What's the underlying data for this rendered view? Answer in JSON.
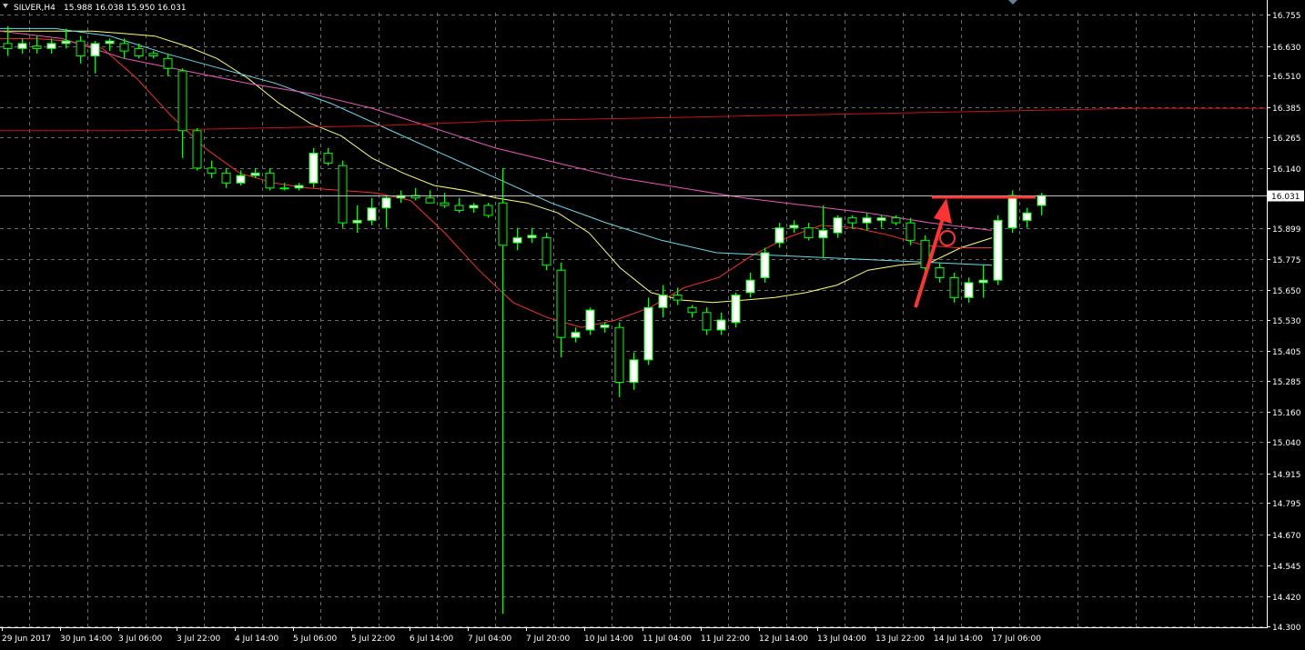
{
  "header": {
    "symbol_label": "SILVER,H4",
    "ohlc": "15.988 16.038 15.950 16.031"
  },
  "colors": {
    "background": "#000000",
    "grid": "#6b6b6b",
    "bull_candle": "#ffffff",
    "bear_candle": "#000000",
    "wick": "#00ff00",
    "ma_yellow": "#ffff66",
    "ma_red": "#ff2a2a",
    "ma_cyan": "#66ddee",
    "ma_magenta": "#ee55bb",
    "ma_darkred": "#cc1111",
    "annotation": "#ff3333",
    "current_price_line": "#bfbfbf"
  },
  "chart_data": {
    "type": "candlestick",
    "timeframe": "H4",
    "y_ticks": [
      16.755,
      16.63,
      16.51,
      16.385,
      16.265,
      16.14,
      15.899,
      15.775,
      15.65,
      15.53,
      15.405,
      15.285,
      15.16,
      15.04,
      14.915,
      14.795,
      14.67,
      14.545,
      14.42,
      14.3
    ],
    "y_tick_labels": [
      "16.755",
      "16.630",
      "16.510",
      "16.385",
      "16.265",
      "16.140",
      "15.899",
      "15.775",
      "15.650",
      "15.530",
      "15.405",
      "15.285",
      "15.160",
      "15.040",
      "14.915",
      "14.795",
      "14.670",
      "14.545",
      "14.420",
      "14.300"
    ],
    "ylim": [
      14.3,
      16.76
    ],
    "current_price": 16.031,
    "current_price_label": "16.031",
    "x_labels": [
      "29 Jun 2017",
      "30 Jun 14:00",
      "3 Jul 06:00",
      "3 Jul 22:00",
      "4 Jul 14:00",
      "5 Jul 06:00",
      "5 Jul 22:00",
      "6 Jul 14:00",
      "7 Jul 04:00",
      "7 Jul 20:00",
      "10 Jul 14:00",
      "11 Jul 04:00",
      "11 Jul 22:00",
      "12 Jul 14:00",
      "13 Jul 04:00",
      "13 Jul 22:00",
      "14 Jul 14:00",
      "17 Jul 06:00"
    ],
    "grid": true,
    "candles": [
      {
        "o": 16.64,
        "h": 16.71,
        "l": 16.59,
        "c": 16.62
      },
      {
        "o": 16.62,
        "h": 16.66,
        "l": 16.6,
        "c": 16.64
      },
      {
        "o": 16.63,
        "h": 16.67,
        "l": 16.6,
        "c": 16.62
      },
      {
        "o": 16.62,
        "h": 16.66,
        "l": 16.6,
        "c": 16.64
      },
      {
        "o": 16.64,
        "h": 16.7,
        "l": 16.62,
        "c": 16.65
      },
      {
        "o": 16.65,
        "h": 16.67,
        "l": 16.56,
        "c": 16.59
      },
      {
        "o": 16.59,
        "h": 16.65,
        "l": 16.52,
        "c": 16.64
      },
      {
        "o": 16.64,
        "h": 16.66,
        "l": 16.61,
        "c": 16.65
      },
      {
        "o": 16.64,
        "h": 16.66,
        "l": 16.58,
        "c": 16.61
      },
      {
        "o": 16.62,
        "h": 16.64,
        "l": 16.58,
        "c": 16.59
      },
      {
        "o": 16.6,
        "h": 16.61,
        "l": 16.58,
        "c": 16.59
      },
      {
        "o": 16.58,
        "h": 16.6,
        "l": 16.51,
        "c": 16.54
      },
      {
        "o": 16.53,
        "h": 16.54,
        "l": 16.18,
        "c": 16.29
      },
      {
        "o": 16.29,
        "h": 16.3,
        "l": 16.13,
        "c": 16.14
      },
      {
        "o": 16.14,
        "h": 16.17,
        "l": 16.1,
        "c": 16.12
      },
      {
        "o": 16.12,
        "h": 16.14,
        "l": 16.06,
        "c": 16.08
      },
      {
        "o": 16.08,
        "h": 16.13,
        "l": 16.07,
        "c": 16.11
      },
      {
        "o": 16.11,
        "h": 16.14,
        "l": 16.1,
        "c": 16.12
      },
      {
        "o": 16.12,
        "h": 16.14,
        "l": 16.05,
        "c": 16.06
      },
      {
        "o": 16.06,
        "h": 16.08,
        "l": 16.05,
        "c": 16.06
      },
      {
        "o": 16.06,
        "h": 16.08,
        "l": 16.05,
        "c": 16.07
      },
      {
        "o": 16.08,
        "h": 16.22,
        "l": 16.06,
        "c": 16.2
      },
      {
        "o": 16.2,
        "h": 16.22,
        "l": 16.15,
        "c": 16.16
      },
      {
        "o": 16.15,
        "h": 16.17,
        "l": 15.9,
        "c": 15.92
      },
      {
        "o": 15.92,
        "h": 15.99,
        "l": 15.88,
        "c": 15.93
      },
      {
        "o": 15.93,
        "h": 16.02,
        "l": 15.91,
        "c": 15.98
      },
      {
        "o": 15.98,
        "h": 16.03,
        "l": 15.9,
        "c": 16.02
      },
      {
        "o": 16.02,
        "h": 16.05,
        "l": 16.0,
        "c": 16.03
      },
      {
        "o": 16.03,
        "h": 16.06,
        "l": 16.01,
        "c": 16.02
      },
      {
        "o": 16.02,
        "h": 16.05,
        "l": 16.0,
        "c": 16.0
      },
      {
        "o": 16.0,
        "h": 16.04,
        "l": 15.98,
        "c": 15.99
      },
      {
        "o": 15.99,
        "h": 16.02,
        "l": 15.96,
        "c": 15.97
      },
      {
        "o": 15.98,
        "h": 16.0,
        "l": 15.96,
        "c": 15.99
      },
      {
        "o": 15.99,
        "h": 16.0,
        "l": 15.94,
        "c": 15.95
      },
      {
        "o": 16.0,
        "h": 16.14,
        "l": 14.35,
        "c": 15.83
      },
      {
        "o": 15.84,
        "h": 15.9,
        "l": 15.81,
        "c": 15.86
      },
      {
        "o": 15.86,
        "h": 15.9,
        "l": 15.84,
        "c": 15.87
      },
      {
        "o": 15.86,
        "h": 15.88,
        "l": 15.73,
        "c": 15.75
      },
      {
        "o": 15.73,
        "h": 15.76,
        "l": 15.38,
        "c": 15.46
      },
      {
        "o": 15.46,
        "h": 15.5,
        "l": 15.44,
        "c": 15.48
      },
      {
        "o": 15.49,
        "h": 15.58,
        "l": 15.47,
        "c": 15.57
      },
      {
        "o": 15.5,
        "h": 15.52,
        "l": 15.48,
        "c": 15.51
      },
      {
        "o": 15.5,
        "h": 15.52,
        "l": 15.22,
        "c": 15.28
      },
      {
        "o": 15.28,
        "h": 15.4,
        "l": 15.25,
        "c": 15.37
      },
      {
        "o": 15.37,
        "h": 15.62,
        "l": 15.35,
        "c": 15.58
      },
      {
        "o": 15.58,
        "h": 15.67,
        "l": 15.54,
        "c": 15.63
      },
      {
        "o": 15.63,
        "h": 15.66,
        "l": 15.59,
        "c": 15.61
      },
      {
        "o": 15.58,
        "h": 15.59,
        "l": 15.54,
        "c": 15.56
      },
      {
        "o": 15.56,
        "h": 15.58,
        "l": 15.47,
        "c": 15.49
      },
      {
        "o": 15.49,
        "h": 15.56,
        "l": 15.47,
        "c": 15.53
      },
      {
        "o": 15.52,
        "h": 15.64,
        "l": 15.5,
        "c": 15.63
      },
      {
        "o": 15.64,
        "h": 15.72,
        "l": 15.62,
        "c": 15.69
      },
      {
        "o": 15.7,
        "h": 15.82,
        "l": 15.68,
        "c": 15.8
      },
      {
        "o": 15.84,
        "h": 15.92,
        "l": 15.82,
        "c": 15.9
      },
      {
        "o": 15.9,
        "h": 15.93,
        "l": 15.88,
        "c": 15.91
      },
      {
        "o": 15.9,
        "h": 15.92,
        "l": 15.85,
        "c": 15.86
      },
      {
        "o": 15.86,
        "h": 15.99,
        "l": 15.78,
        "c": 15.89
      },
      {
        "o": 15.88,
        "h": 15.95,
        "l": 15.86,
        "c": 15.94
      },
      {
        "o": 15.94,
        "h": 15.95,
        "l": 15.9,
        "c": 15.92
      },
      {
        "o": 15.92,
        "h": 15.96,
        "l": 15.89,
        "c": 15.94
      },
      {
        "o": 15.93,
        "h": 15.95,
        "l": 15.9,
        "c": 15.94
      },
      {
        "o": 15.94,
        "h": 15.95,
        "l": 15.91,
        "c": 15.92
      },
      {
        "o": 15.92,
        "h": 15.94,
        "l": 15.83,
        "c": 15.85
      },
      {
        "o": 15.85,
        "h": 15.87,
        "l": 15.72,
        "c": 15.74
      },
      {
        "o": 15.74,
        "h": 15.76,
        "l": 15.68,
        "c": 15.7
      },
      {
        "o": 15.7,
        "h": 15.72,
        "l": 15.6,
        "c": 15.62
      },
      {
        "o": 15.62,
        "h": 15.7,
        "l": 15.6,
        "c": 15.68
      },
      {
        "o": 15.68,
        "h": 15.75,
        "l": 15.62,
        "c": 15.69
      },
      {
        "o": 15.69,
        "h": 15.95,
        "l": 15.67,
        "c": 15.93
      },
      {
        "o": 15.9,
        "h": 16.05,
        "l": 15.88,
        "c": 16.03
      },
      {
        "o": 15.93,
        "h": 15.98,
        "l": 15.9,
        "c": 15.96
      },
      {
        "o": 15.99,
        "h": 16.04,
        "l": 15.95,
        "c": 16.03
      }
    ],
    "moving_averages": [
      {
        "color": "ma_yellow",
        "values": [
          16.69,
          16.69,
          16.69,
          16.69,
          16.68,
          16.67,
          16.63,
          16.58,
          16.5,
          16.4,
          16.32,
          16.27,
          16.18,
          16.12,
          16.07,
          16.05,
          16.02,
          16.0,
          15.96,
          15.88,
          15.74,
          15.64,
          15.61,
          15.6,
          15.61,
          15.62,
          15.64,
          15.67,
          15.73,
          15.75,
          15.76,
          15.82,
          15.86
        ]
      },
      {
        "color": "ma_red",
        "values": [
          16.66,
          16.66,
          16.65,
          16.62,
          16.5,
          16.35,
          16.22,
          16.12,
          16.08,
          16.06,
          16.05,
          16.04,
          16.01,
          15.88,
          15.73,
          15.6,
          15.54,
          15.5,
          15.53,
          15.58,
          15.66,
          15.7,
          15.79,
          15.86,
          15.91,
          15.9,
          15.87,
          15.83,
          15.82,
          15.82
        ]
      },
      {
        "color": "ma_cyan",
        "values": [
          16.7,
          16.7,
          16.67,
          16.6,
          16.54,
          16.48,
          16.4,
          16.3,
          16.2,
          16.1,
          16.0,
          15.92,
          15.85,
          15.8,
          15.79,
          15.78,
          15.77,
          15.76,
          15.75
        ]
      },
      {
        "color": "ma_magenta",
        "values": [
          16.69,
          16.66,
          16.58,
          16.53,
          16.48,
          16.44,
          16.38,
          16.3,
          16.22,
          16.16,
          16.1,
          16.06,
          16.02,
          15.99,
          15.96,
          15.92,
          15.89
        ]
      },
      {
        "color": "ma_darkred",
        "values": [
          16.29,
          16.29,
          16.3,
          16.31,
          16.33,
          16.34,
          16.35,
          16.36,
          16.37,
          16.38,
          16.38
        ]
      }
    ]
  }
}
